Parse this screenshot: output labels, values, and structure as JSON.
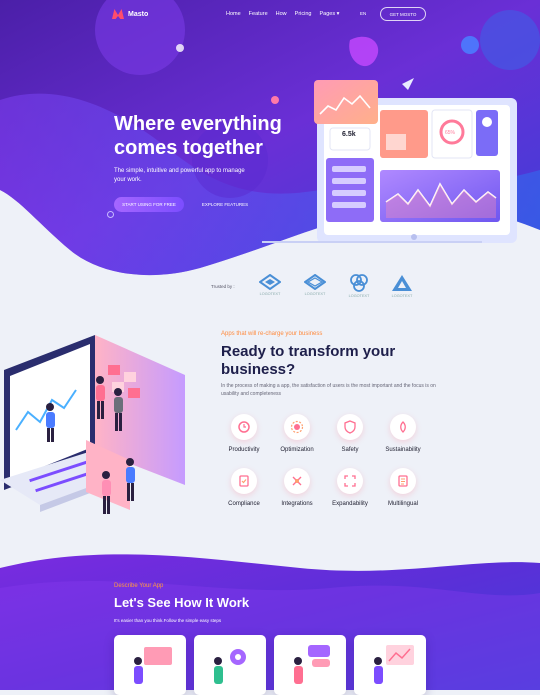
{
  "nav": {
    "brand": "Masto",
    "links": [
      "Home",
      "Feature",
      "How",
      "Pricing",
      "Pages ▾"
    ],
    "lang": "EN",
    "cta": "GET MOSTO"
  },
  "hero": {
    "title": "Where everything comes together",
    "subtitle": "The simple, intuitive and powerful app to manage your work.",
    "primary_button": "START USING FOR FREE",
    "secondary_button": "EXPLORE FEATURES",
    "stat_value": "6.5k",
    "percent_value": "65%"
  },
  "trusted": {
    "label": "Trusted by :",
    "logos": [
      "LOGOTEXT",
      "LOGOTEXT",
      "LOGOTEXT",
      "LOGOTEXT"
    ]
  },
  "features_section": {
    "eyebrow": "Apps that will re-charge your business",
    "title": "Ready to transform your business?",
    "description": "In the process of making a app, the satisfaction of users is the most important and the focus is on usability and completeness",
    "features": [
      "Productivity",
      "Optimization",
      "Safety",
      "Sustainability",
      "Compliance",
      "Integrations",
      "Expandability",
      "Multilingual"
    ]
  },
  "how_section": {
    "eyebrow": "Describe Your App",
    "title": "Let's See How It Work",
    "subtitle": "It's easier than you think.Follow the simple easy steps"
  },
  "colors": {
    "hero_purple": "#6a2fd6",
    "accent_orange": "#ff8a3d",
    "title_navy": "#1e1f4b",
    "brand_red": "#ff4d6d"
  }
}
